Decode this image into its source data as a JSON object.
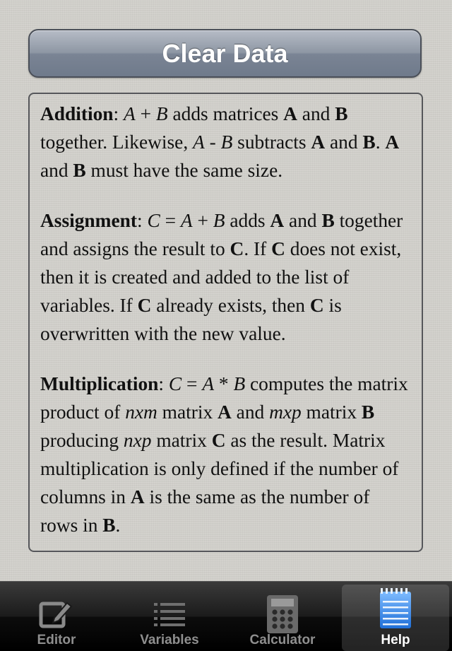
{
  "clear_button": {
    "label": "Clear Data"
  },
  "help": {
    "sections": [
      [
        {
          "t": "Addition",
          "s": "b"
        },
        {
          "t": ": ",
          "s": ""
        },
        {
          "t": "A",
          "s": "i"
        },
        {
          "t": " + ",
          "s": ""
        },
        {
          "t": "B",
          "s": "i"
        },
        {
          "t": " adds matrices ",
          "s": ""
        },
        {
          "t": "A",
          "s": "b"
        },
        {
          "t": " and ",
          "s": ""
        },
        {
          "t": "B",
          "s": "b"
        },
        {
          "t": " together. Likewise, ",
          "s": ""
        },
        {
          "t": "A",
          "s": "i"
        },
        {
          "t": " - ",
          "s": ""
        },
        {
          "t": "B",
          "s": "i"
        },
        {
          "t": " subtracts ",
          "s": ""
        },
        {
          "t": "A",
          "s": "b"
        },
        {
          "t": " and ",
          "s": ""
        },
        {
          "t": "B",
          "s": "b"
        },
        {
          "t": ". ",
          "s": ""
        },
        {
          "t": "A",
          "s": "b"
        },
        {
          "t": " and ",
          "s": ""
        },
        {
          "t": "B",
          "s": "b"
        },
        {
          "t": " must have the same size.",
          "s": ""
        }
      ],
      [
        {
          "t": "Assignment",
          "s": "b"
        },
        {
          "t": ": ",
          "s": ""
        },
        {
          "t": "C",
          "s": "i"
        },
        {
          "t": " = ",
          "s": ""
        },
        {
          "t": "A",
          "s": "i"
        },
        {
          "t": " + ",
          "s": ""
        },
        {
          "t": "B",
          "s": "i"
        },
        {
          "t": " adds ",
          "s": ""
        },
        {
          "t": "A",
          "s": "b"
        },
        {
          "t": " and ",
          "s": ""
        },
        {
          "t": "B",
          "s": "b"
        },
        {
          "t": " together and assigns the result to ",
          "s": ""
        },
        {
          "t": "C",
          "s": "b"
        },
        {
          "t": ". If ",
          "s": ""
        },
        {
          "t": "C",
          "s": "b"
        },
        {
          "t": " does not exist, then it is created and added to the list of variables. If ",
          "s": ""
        },
        {
          "t": "C",
          "s": "b"
        },
        {
          "t": " already exists, then ",
          "s": ""
        },
        {
          "t": "C",
          "s": "b"
        },
        {
          "t": " is overwritten with the new value.",
          "s": ""
        }
      ],
      [
        {
          "t": "Multiplication",
          "s": "b"
        },
        {
          "t": ": ",
          "s": ""
        },
        {
          "t": "C",
          "s": "i"
        },
        {
          "t": " = ",
          "s": ""
        },
        {
          "t": "A",
          "s": "i"
        },
        {
          "t": " * ",
          "s": ""
        },
        {
          "t": "B",
          "s": "i"
        },
        {
          "t": " computes the matrix product of ",
          "s": ""
        },
        {
          "t": "nxm",
          "s": "i"
        },
        {
          "t": " matrix ",
          "s": ""
        },
        {
          "t": "A",
          "s": "b"
        },
        {
          "t": " and ",
          "s": ""
        },
        {
          "t": "mxp",
          "s": "i"
        },
        {
          "t": " matrix ",
          "s": ""
        },
        {
          "t": "B",
          "s": "b"
        },
        {
          "t": " producing ",
          "s": ""
        },
        {
          "t": "nxp",
          "s": "i"
        },
        {
          "t": " matrix ",
          "s": ""
        },
        {
          "t": "C",
          "s": "b"
        },
        {
          "t": " as the result. Matrix multiplication is only defined if the number of columns in ",
          "s": ""
        },
        {
          "t": "A",
          "s": "b"
        },
        {
          "t": " is the same as the number of rows in ",
          "s": ""
        },
        {
          "t": "B",
          "s": "b"
        },
        {
          "t": ".",
          "s": ""
        }
      ]
    ]
  },
  "tabs": [
    {
      "label": "Editor",
      "icon": "edit-icon",
      "active": false
    },
    {
      "label": "Variables",
      "icon": "list-icon",
      "active": false
    },
    {
      "label": "Calculator",
      "icon": "calculator-icon",
      "active": false
    },
    {
      "label": "Help",
      "icon": "notepad-icon",
      "active": true
    }
  ],
  "colors": {
    "accent": "#3c8ee8",
    "button": "#7e8898",
    "tabbar": "#000000"
  }
}
